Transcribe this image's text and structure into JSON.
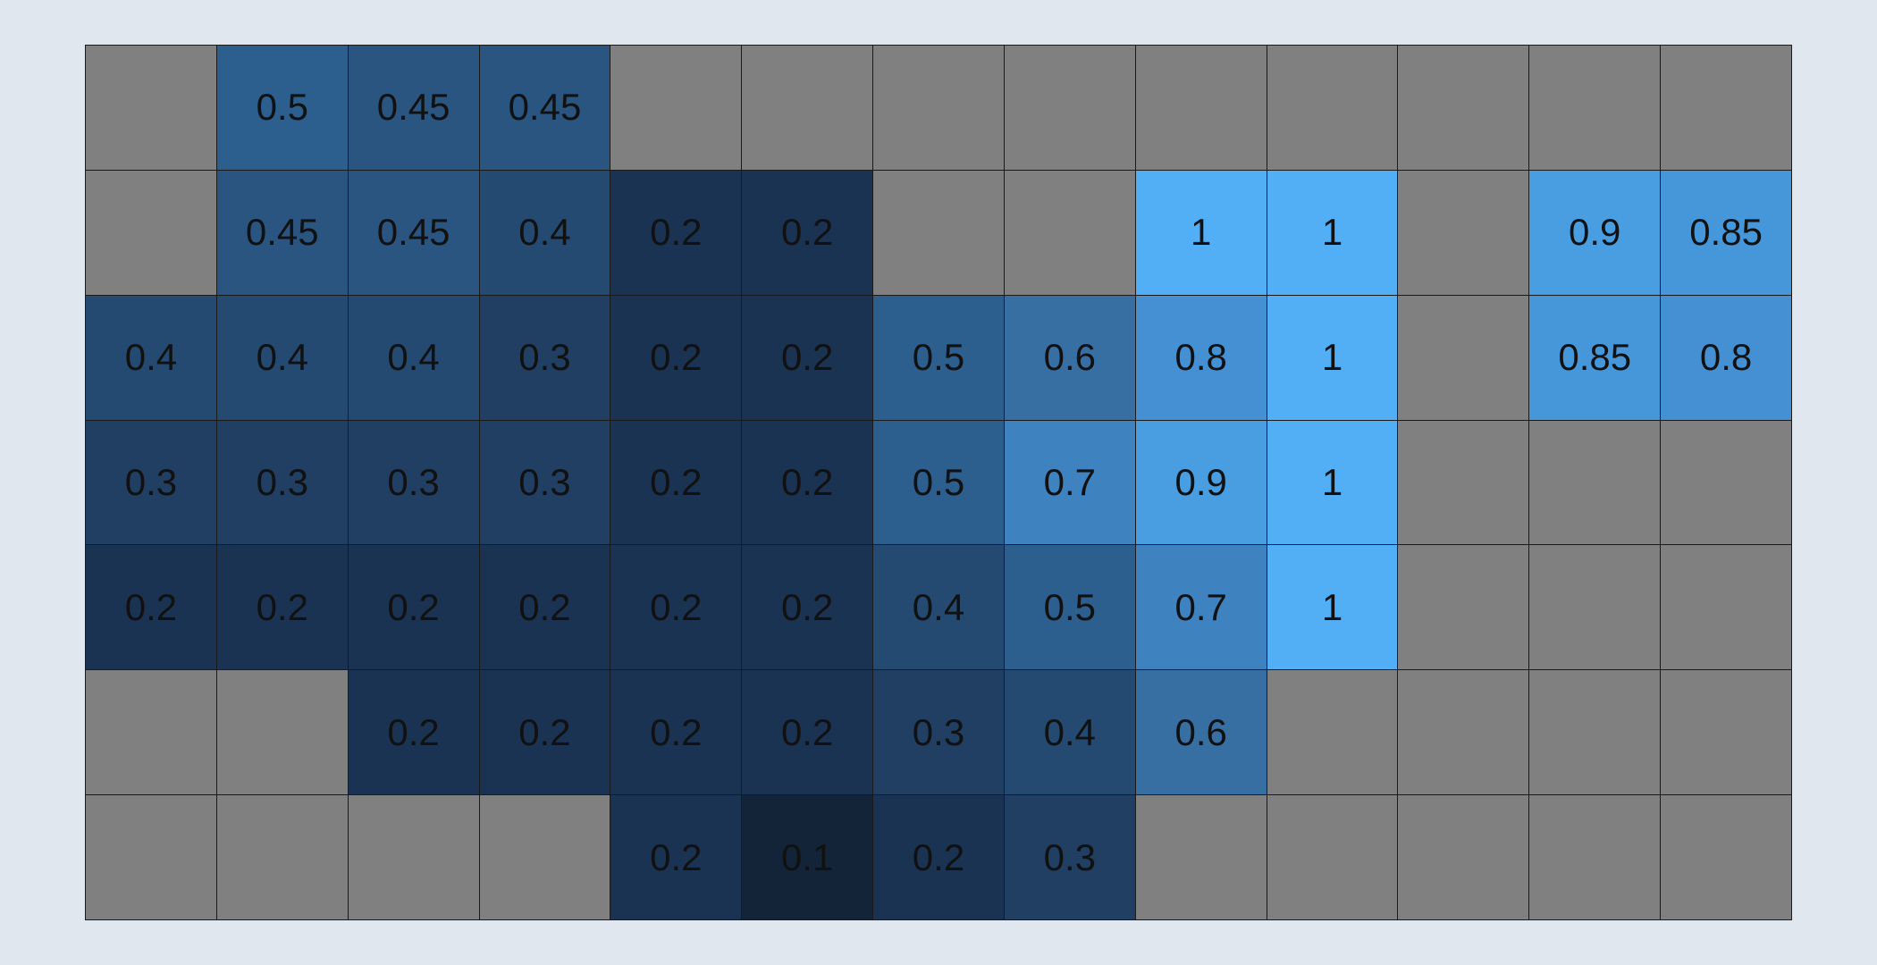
{
  "chart_data": {
    "type": "heatmap",
    "rows": 7,
    "cols": 13,
    "colors": {
      "empty": "#808080",
      "low": "#142438",
      "high": "#52aef5",
      "background": "#e1e7ee",
      "text": "#111111"
    },
    "value_range": [
      0.1,
      1
    ],
    "grid": [
      [
        null,
        0.5,
        0.45,
        0.45,
        null,
        null,
        null,
        null,
        null,
        null,
        null,
        null,
        null
      ],
      [
        null,
        0.45,
        0.45,
        0.4,
        0.2,
        0.2,
        null,
        null,
        1,
        1,
        null,
        0.9,
        0.85
      ],
      [
        0.4,
        0.4,
        0.4,
        0.3,
        0.2,
        0.2,
        0.5,
        0.6,
        0.8,
        1,
        null,
        0.85,
        0.8
      ],
      [
        0.3,
        0.3,
        0.3,
        0.3,
        0.2,
        0.2,
        0.5,
        0.7,
        0.9,
        1,
        null,
        null,
        null
      ],
      [
        0.2,
        0.2,
        0.2,
        0.2,
        0.2,
        0.2,
        0.4,
        0.5,
        0.7,
        1,
        null,
        null,
        null
      ],
      [
        null,
        null,
        0.2,
        0.2,
        0.2,
        0.2,
        0.3,
        0.4,
        0.6,
        null,
        null,
        null,
        null
      ],
      [
        null,
        null,
        null,
        null,
        0.2,
        0.1,
        0.2,
        0.3,
        null,
        null,
        null,
        null,
        null
      ]
    ],
    "labels": [
      [
        "",
        "0.5",
        "0.45",
        "0.45",
        "",
        "",
        "",
        "",
        "",
        "",
        "",
        "",
        ""
      ],
      [
        "",
        "0.45",
        "0.45",
        "0.4",
        "0.2",
        "0.2",
        "",
        "",
        "1",
        "1",
        "",
        "0.9",
        "0.85"
      ],
      [
        "0.4",
        "0.4",
        "0.4",
        "0.3",
        "0.2",
        "0.2",
        "0.5",
        "0.6",
        "0.8",
        "1",
        "",
        "0.85",
        "0.8"
      ],
      [
        "0.3",
        "0.3",
        "0.3",
        "0.3",
        "0.2",
        "0.2",
        "0.5",
        "0.7",
        "0.9",
        "1",
        "",
        "",
        ""
      ],
      [
        "0.2",
        "0.2",
        "0.2",
        "0.2",
        "0.2",
        "0.2",
        "0.4",
        "0.5",
        "0.7",
        "1",
        "",
        "",
        ""
      ],
      [
        "",
        "",
        "0.2",
        "0.2",
        "0.2",
        "0.2",
        "0.3",
        "0.4",
        "0.6",
        "",
        "",
        "",
        ""
      ],
      [
        "",
        "",
        "",
        "",
        "0.2",
        "0.1",
        "0.2",
        "0.3",
        "",
        "",
        "",
        "",
        ""
      ]
    ]
  }
}
